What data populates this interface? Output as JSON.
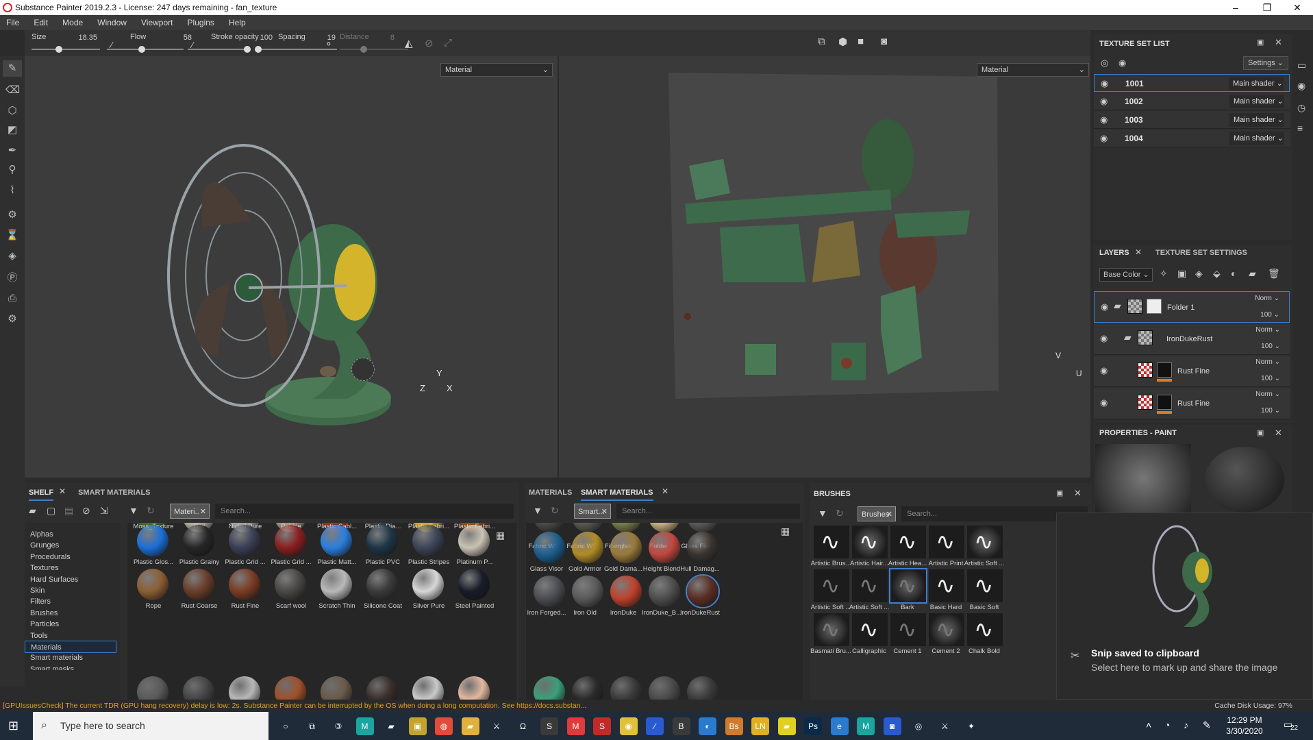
{
  "window": {
    "title": "Substance Painter 2019.2.3 - License: 247 days remaining - fan_texture"
  },
  "menu": [
    "File",
    "Edit",
    "Mode",
    "Window",
    "Viewport",
    "Plugins",
    "Help"
  ],
  "tool_options": {
    "size_label": "Size",
    "size_value": "18.35",
    "flow_label": "Flow",
    "flow_value": "58",
    "stroke_label": "Stroke opacity",
    "stroke_value": "100",
    "spacing_label": "Spacing",
    "spacing_value": "19",
    "distance_label": "Distance",
    "distance_value": "8"
  },
  "viewport3d": {
    "mode": "Material",
    "axis_z": "Z",
    "axis_y": "Y",
    "axis_x": "X"
  },
  "viewport2d": {
    "mode": "Material",
    "axis_v": "V",
    "axis_u": "U"
  },
  "texture_set_list": {
    "title": "TEXTURE SET LIST",
    "settings_label": "Settings",
    "sets": [
      {
        "name": "1001",
        "shader": "Main shader"
      },
      {
        "name": "1002",
        "shader": "Main shader"
      },
      {
        "name": "1003",
        "shader": "Main shader"
      },
      {
        "name": "1004",
        "shader": "Main shader"
      }
    ]
  },
  "layers": {
    "tab_layers": "LAYERS",
    "tab_texture_settings": "TEXTURE SET SETTINGS",
    "channel": "Base Color",
    "items": [
      {
        "name": "Folder 1",
        "blend": "Norm",
        "opacity": "100"
      },
      {
        "name": "IronDukeRust",
        "blend": "Norm",
        "opacity": "100"
      },
      {
        "name": "Rust Fine",
        "blend": "Norm",
        "opacity": "100"
      },
      {
        "name": "Rust Fine",
        "blend": "Norm",
        "opacity": "100"
      }
    ]
  },
  "properties": {
    "title": "PROPERTIES - PAINT"
  },
  "shelf": {
    "tab_shelf": "SHELF",
    "tab_smart": "SMART MATERIALS",
    "filter_chip": "Materi..",
    "search_placeholder": "Search...",
    "categories": [
      "Alphas",
      "Grunges",
      "Procedurals",
      "Textures",
      "Hard Surfaces",
      "Skin",
      "Filters",
      "Brushes",
      "Particles",
      "Tools",
      "Materials",
      "Smart materials",
      "Smart masks"
    ],
    "selected_category": "Materials",
    "materials": [
      {
        "label": "Moss_Texture",
        "color": "#4b6b2b"
      },
      {
        "label": "Nail",
        "color": "#b8b0a2"
      },
      {
        "label": "Nickel Pure",
        "color": "#a8a39a"
      },
      {
        "label": "Pebble",
        "color": "#a49a88"
      },
      {
        "label": "Plastic Cabl...",
        "color": "#8d3a25"
      },
      {
        "label": "Plastic Dia...",
        "color": "#3d3d3d"
      },
      {
        "label": "Plastic Fabri...",
        "color": "#d6b022"
      },
      {
        "label": "Plastic Fabri...",
        "color": "#9a4a1f"
      },
      {
        "label": "Plastic Glos...",
        "color": "#1c6fd8"
      },
      {
        "label": "Plastic Grainy",
        "color": "#262626"
      },
      {
        "label": "Plastic Grid ...",
        "color": "#3a3f55"
      },
      {
        "label": "Plastic Grid ...",
        "color": "#8a1f1f"
      },
      {
        "label": "Plastic Matt...",
        "color": "#2a7fe0"
      },
      {
        "label": "Plastic PVC",
        "color": "#1d3646"
      },
      {
        "label": "Plastic Stripes",
        "color": "#3c4558"
      },
      {
        "label": "Platinum P...",
        "color": "#c9c3b4"
      },
      {
        "label": "Rope",
        "color": "#8b5e33"
      },
      {
        "label": "Rust Coarse",
        "color": "#6a3d2b"
      },
      {
        "label": "Rust Fine",
        "color": "#7b3b23"
      },
      {
        "label": "Scarf wool",
        "color": "#4a4844"
      },
      {
        "label": "Scratch Thin",
        "color": "#b9b9b9"
      },
      {
        "label": "Silicone Coat",
        "color": "#3a3a3a"
      },
      {
        "label": "Silver Pure",
        "color": "#d7d7d7"
      },
      {
        "label": "Steel Painted",
        "color": "#181c28"
      }
    ]
  },
  "smart_materials": {
    "tab_materials": "MATERIALS",
    "tab_smart": "SMART MATERIALS",
    "filter_chip": "Smart...",
    "search_placeholder": "Search...",
    "items": [
      {
        "label": "Fabric WO...",
        "color": "#4a4a46"
      },
      {
        "label": "Fabric WO...",
        "color": "#5a5a52"
      },
      {
        "label": "Fiberglass ...",
        "color": "#7a7d4a"
      },
      {
        "label": "Folder 5",
        "color": "#c7b27a"
      },
      {
        "label": "Glass Film ...",
        "color": "#5a5a5a"
      },
      {
        "label": "Glass Visor",
        "color": "#1b5f8f"
      },
      {
        "label": "Gold Armor",
        "color": "#b18b25"
      },
      {
        "label": "Gold Dama...",
        "color": "#9a7a3a"
      },
      {
        "label": "Height Blend",
        "color": "#c0473e"
      },
      {
        "label": "Hull Damag...",
        "color": "#3a3430"
      },
      {
        "label": "Iron Forged...",
        "color": "#4b4e52"
      },
      {
        "label": "Iron Old",
        "color": "#5a5a5a"
      },
      {
        "label": "IronDuke",
        "color": "#c0412c"
      },
      {
        "label": "IronDuke_B...",
        "color": "#4e4e4e"
      },
      {
        "label": "IronDukeRust",
        "color": "#5a2e22"
      }
    ],
    "selected": "IronDukeRust"
  },
  "brushes": {
    "title": "BRUSHES",
    "filter_chip": "Brushes",
    "search_placeholder": "Search...",
    "items": [
      "Artistic Brus...",
      "Artistic Hair...",
      "Artistic Hea...",
      "Artistic Print",
      "Artistic Soft ...",
      "Artistic Soft ...",
      "Artistic Soft ...",
      "Bark",
      "Basic Hard",
      "Basic Soft",
      "Basmati Bru...",
      "Calligraphic",
      "Cement 1",
      "Cement 2",
      "Chalk Bold"
    ],
    "selected": "Bark"
  },
  "toast": {
    "title": "Snip saved to clipboard",
    "body": "Select here to mark up and share the image"
  },
  "status": {
    "message": "[GPUIssuesCheck] The current TDR (GPU hang recovery) delay is low: 2s. Substance Painter can be interrupted by the OS when doing a long computation. See https://docs.substan...",
    "cache": "Cache Disk Usage:  97%"
  },
  "taskbar": {
    "search_placeholder": "Type here to search",
    "time": "12:29 PM",
    "date": "3/30/2020",
    "notification_count": "22"
  }
}
